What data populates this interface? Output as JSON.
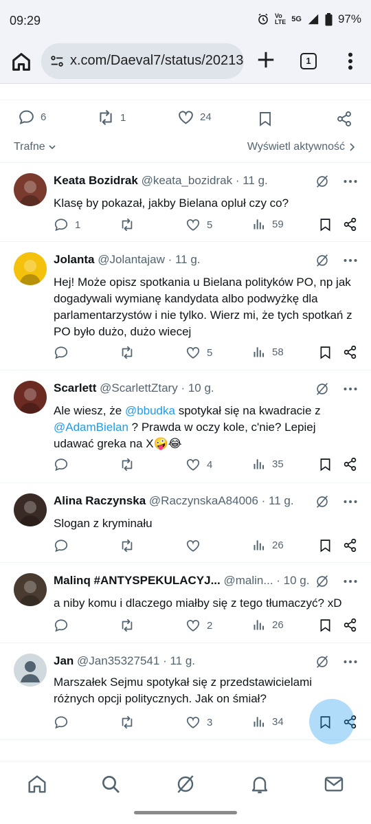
{
  "status_bar": {
    "time": "09:29",
    "network_line1": "Vo",
    "network_line2": "LTE",
    "network_type": "5G",
    "battery": "97%"
  },
  "browser": {
    "url": "x.com/Daeval7/status/20213",
    "tab_count": "1"
  },
  "post_actions": {
    "replies": "6",
    "reposts": "1",
    "likes": "24"
  },
  "sorting": {
    "filter_label": "Trafne",
    "activity_link": "Wyświetl aktywność"
  },
  "replies": [
    {
      "name": "Keata Bozidrak",
      "handle": "@keata_bozidrak",
      "time": "· 11 g.",
      "text": [
        {
          "t": "Klasę by pokazał, jakby Bielana opluł czy co?"
        }
      ],
      "replies": "1",
      "reposts": "",
      "likes": "5",
      "views": "59",
      "avatar_color": "#7a3b2e"
    },
    {
      "name": "Jolanta",
      "handle": "@Jolantajaw",
      "time": "· 11 g.",
      "text": [
        {
          "t": "Hej! Może opisz spotkania u Bielana polityków PO, np jak dogadywali wymianę kandydata albo podwyżkę dla parlamentarzystów i nie tylko. Wierz mi, że tych spotkań z PO było dużo, dużo wiecej"
        }
      ],
      "replies": "",
      "reposts": "",
      "likes": "5",
      "views": "58",
      "avatar_color": "#f4c20d"
    },
    {
      "name": "Scarlett",
      "handle": "@ScarlettZtary",
      "time": "· 10 g.",
      "text": [
        {
          "t": "Ale wiesz, że "
        },
        {
          "t": "@bbudka",
          "link": true
        },
        {
          "t": " spotykał się na kwadracie z "
        },
        {
          "t": "@AdamBielan",
          "link": true
        },
        {
          "t": " ? Prawda w oczy kole, c'nie? Lepiej udawać greka na X🤪😂"
        }
      ],
      "replies": "",
      "reposts": "",
      "likes": "4",
      "views": "35",
      "avatar_color": "#6b2a22"
    },
    {
      "name": "Alina Raczynska",
      "handle": "@RaczynskaA84006",
      "time": "· 11 g.",
      "text": [
        {
          "t": "Slogan z kryminału"
        }
      ],
      "replies": "",
      "reposts": "",
      "likes": "",
      "views": "26",
      "avatar_color": "#3a2a25"
    },
    {
      "name": "Malinq #ANTYSPEKULACYJ...",
      "handle": "@malin...",
      "time": "· 10 g.",
      "text": [
        {
          "t": "a niby komu i dlaczego miałby się z tego tłumaczyć? xD"
        }
      ],
      "replies": "",
      "reposts": "",
      "likes": "2",
      "views": "26",
      "avatar_color": "#4a3b30"
    },
    {
      "name": "Jan",
      "handle": "@Jan35327541",
      "time": "· 11 g.",
      "text": [
        {
          "t": "Marszałek Sejmu spotykał się z przedstawicielami różnych opcji politycznych. Jak on śmiał?"
        }
      ],
      "replies": "",
      "reposts": "",
      "likes": "3",
      "views": "34",
      "avatar_color": "#cfd9de"
    }
  ],
  "bottom_nav": [
    "home-icon",
    "search-icon",
    "grok-icon",
    "notifications-icon",
    "messages-icon"
  ]
}
